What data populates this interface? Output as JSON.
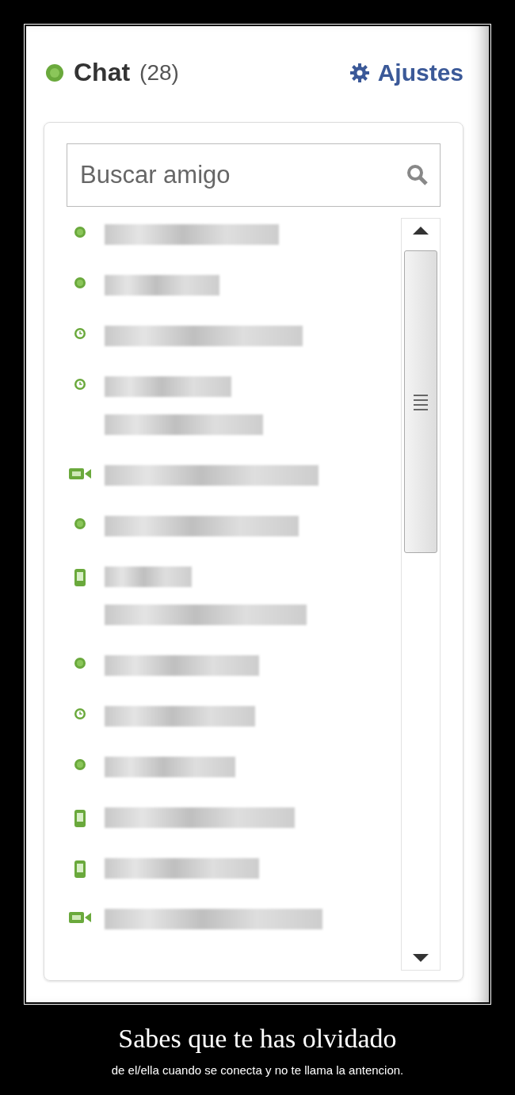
{
  "chat": {
    "title": "Chat",
    "count": "(28)",
    "settings": "Ajustes",
    "search": {
      "placeholder": "Buscar amigo"
    },
    "contacts": [
      {
        "kind": "online",
        "wrapped": false
      },
      {
        "kind": "online",
        "wrapped": false
      },
      {
        "kind": "idle",
        "wrapped": false
      },
      {
        "kind": "idle",
        "wrapped": true
      },
      {
        "kind": "video",
        "wrapped": false
      },
      {
        "kind": "online",
        "wrapped": false
      },
      {
        "kind": "mobile",
        "wrapped": true
      },
      {
        "kind": "online",
        "wrapped": false
      },
      {
        "kind": "idle",
        "wrapped": false
      },
      {
        "kind": "online",
        "wrapped": false
      },
      {
        "kind": "mobile",
        "wrapped": false
      },
      {
        "kind": "mobile",
        "wrapped": false
      },
      {
        "kind": "video",
        "wrapped": false
      }
    ]
  },
  "caption": {
    "title": "Sabes que te has olvidado",
    "subtitle": "de el/ella cuando se conecta y no te llama la antencion."
  }
}
